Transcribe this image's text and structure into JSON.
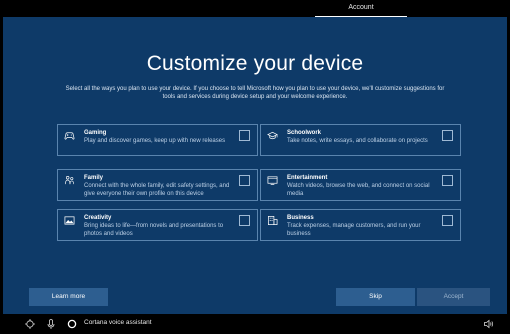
{
  "top_tab": {
    "label": "Account"
  },
  "page": {
    "title": "Customize your device",
    "subtitle": "Select all the ways you plan to use your device. If you choose to tell Microsoft how you plan to use your device, we'll customize suggestions for tools and services during device setup and your welcome experience."
  },
  "options": [
    {
      "name": "Gaming",
      "desc": "Play and discover games, keep up with new releases",
      "icon": "gamepad-icon",
      "checked": false
    },
    {
      "name": "Schoolwork",
      "desc": "Take notes, write essays, and collaborate on projects",
      "icon": "graduation-cap-icon",
      "checked": false
    },
    {
      "name": "Family",
      "desc": "Connect with the whole family, edit safety settings, and give everyone their own profile on this device",
      "icon": "family-icon",
      "checked": false
    },
    {
      "name": "Entertainment",
      "desc": "Watch videos, browse the web, and connect on social media",
      "icon": "media-icon",
      "checked": false
    },
    {
      "name": "Creativity",
      "desc": "Bring ideas to life—from novels and presentations to photos and videos",
      "icon": "picture-icon",
      "checked": false
    },
    {
      "name": "Business",
      "desc": "Track expenses, manage customers, and run your business",
      "icon": "briefcase-building-icon",
      "checked": false
    }
  ],
  "buttons": {
    "learn_more": "Learn more",
    "skip": "Skip",
    "accept": "Accept"
  },
  "taskbar": {
    "cortana": "Cortana voice assistant"
  },
  "colors": {
    "panel": "#0e3a68",
    "card_border": "#5a84ae",
    "button": "#2d5e90"
  }
}
